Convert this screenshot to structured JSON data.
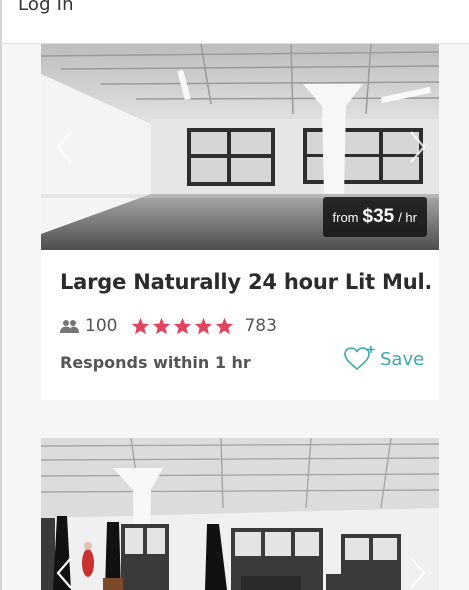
{
  "header": {
    "login_label": "Log In"
  },
  "listings": [
    {
      "price_from": "from",
      "price_amount": "$35",
      "price_unit": "/ hr",
      "title": "Large Naturally 24 hour Lit Mul...",
      "capacity": "100",
      "rating_stars": 5,
      "reviews": "783",
      "response": "Responds within 1 hr",
      "save_label": "Save"
    }
  ],
  "colors": {
    "star": "#e0445f",
    "save_accent": "#3aa9a8",
    "price_tag_bg": "#141416"
  },
  "icons": [
    "chevron-left-icon",
    "chevron-right-icon",
    "people-icon",
    "star-icon",
    "heart-plus-icon"
  ]
}
